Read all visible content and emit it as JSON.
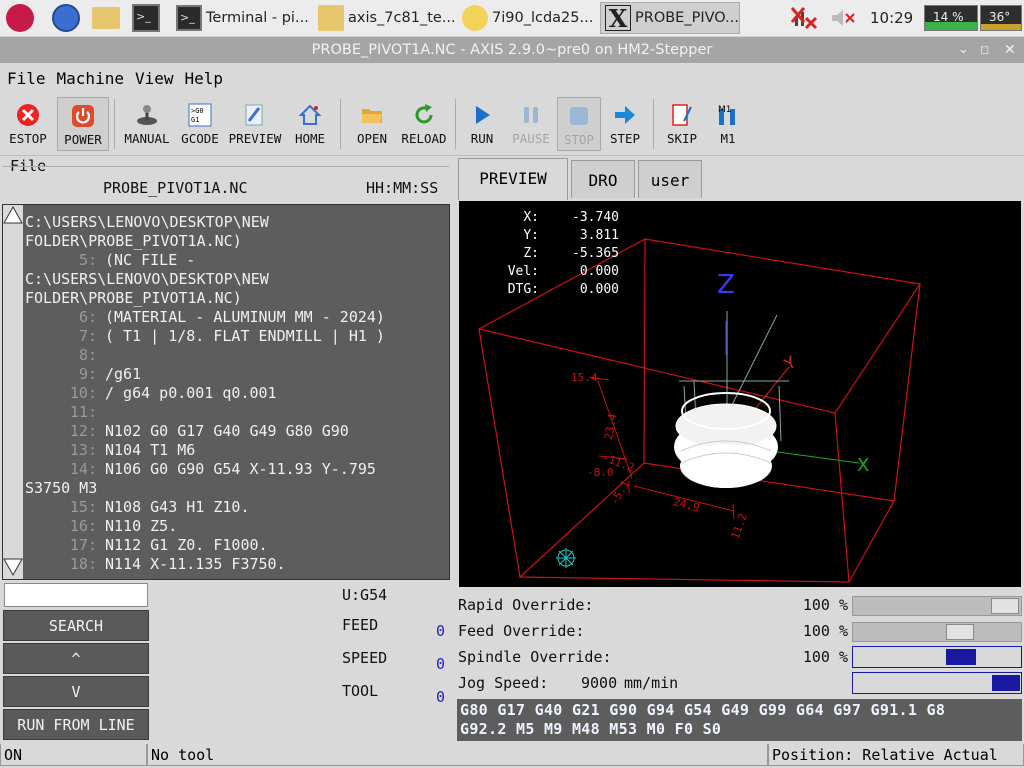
{
  "taskbar": {
    "apps": [
      "Terminal - pi...",
      "axis_7c81_te...",
      "7i90_lcda25...",
      "PROBE_PIVO..."
    ],
    "clock": "10:29",
    "cpu": "14 %",
    "temp": "36°"
  },
  "window": {
    "title": "PROBE_PIVOT1A.NC - AXIS 2.9.0~pre0 on HM2-Stepper"
  },
  "menu": [
    "File",
    "Machine",
    "View",
    "Help"
  ],
  "toolbar": {
    "estop": "ESTOP",
    "power": "POWER",
    "manual": "MANUAL",
    "gcode": "GCODE",
    "preview": "PREVIEW",
    "home": "HOME",
    "open": "OPEN",
    "reload": "RELOAD",
    "run": "RUN",
    "pause": "PAUSE",
    "stop": "STOP",
    "step": "STEP",
    "skip": "SKIP",
    "m1": "M1"
  },
  "file": {
    "section_label": "File",
    "name": "PROBE_PIVOT1A.NC",
    "time_label": "HH:MM:SS",
    "lines": [
      {
        "n": "",
        "t": "C:\\USERS\\LENOVO\\DESKTOP\\NEW"
      },
      {
        "n": "",
        "t": "FOLDER\\PROBE_PIVOT1A.NC)"
      },
      {
        "n": "5:",
        "t": "(NC FILE -"
      },
      {
        "n": "",
        "t": "C:\\USERS\\LENOVO\\DESKTOP\\NEW"
      },
      {
        "n": "",
        "t": "FOLDER\\PROBE_PIVOT1A.NC)"
      },
      {
        "n": "6:",
        "t": "(MATERIAL - ALUMINUM MM - 2024)"
      },
      {
        "n": "7:",
        "t": "( T1 | 1/8. FLAT ENDMILL | H1 )"
      },
      {
        "n": "8:",
        "t": ""
      },
      {
        "n": "9:",
        "t": "/g61"
      },
      {
        "n": "10:",
        "t": "/ g64 p0.001 q0.001"
      },
      {
        "n": "11:",
        "t": ""
      },
      {
        "n": "12:",
        "t": "N102 G0 G17 G40 G49 G80 G90"
      },
      {
        "n": "13:",
        "t": "N104 T1 M6"
      },
      {
        "n": "14:",
        "t": "N106 G0 G90 G54 X-11.93 Y-.795"
      },
      {
        "n": "",
        "t": "S3750 M3"
      },
      {
        "n": "15:",
        "t": "N108 G43 H1 Z10."
      },
      {
        "n": "16:",
        "t": "N110 Z5."
      },
      {
        "n": "17:",
        "t": "N112 G1 Z0. F1000."
      },
      {
        "n": "18:",
        "t": "N114 X-11.135 F3750."
      }
    ]
  },
  "search": {
    "value": "",
    "button": "SEARCH",
    "up": "^",
    "down": "V",
    "run_from_line": "RUN FROM LINE"
  },
  "status": {
    "coord": "U:G54",
    "feed_label": "FEED",
    "feed": "0",
    "speed_label": "SPEED",
    "speed": "0",
    "tool_label": "TOOL",
    "tool": "0"
  },
  "tabs": [
    "PREVIEW",
    "DRO",
    "user"
  ],
  "dro": {
    "x_label": "X:",
    "x": "-3.740",
    "y_label": "Y:",
    "y": "3.811",
    "z_label": "Z:",
    "z": "-5.365",
    "vel_label": "Vel:",
    "vel": "0.000",
    "dtg_label": "DTG:",
    "dtg": "0.000"
  },
  "preview_labels": {
    "z_axis": "Z",
    "y_axis": "Y",
    "x_axis": "X",
    "dim1": "15.4",
    "dim2": "23.4",
    "dim3": "-11.2",
    "dim4": "-8.0",
    "dim5": "-5.1",
    "dim6": "24.9",
    "dim7": "11.2"
  },
  "overrides": {
    "rapid_label": "Rapid Override:",
    "rapid": "100 %",
    "feed_label": "Feed Override:",
    "feed": "100 %",
    "spindle_label": "Spindle Override:",
    "spindle": "100 %",
    "jog_label": "Jog Speed:",
    "jog": "9000",
    "jog_unit": "mm/min"
  },
  "active_gcodes": [
    "G80 G17 G40 G21 G90 G94 G54 G49 G99 G64 G97 G91.1 G8",
    "G92.2 M5 M9 M48 M53 M0 F0 S0"
  ],
  "statusbar": {
    "state": "ON",
    "tool": "No tool",
    "position": "Position: Relative Actual"
  },
  "colors": {
    "panel": "#5d5d5d",
    "accent_blue": "#1818a0",
    "preview_bg": "#000000",
    "toolpath": "#ffffff",
    "box": "#cc1111"
  }
}
